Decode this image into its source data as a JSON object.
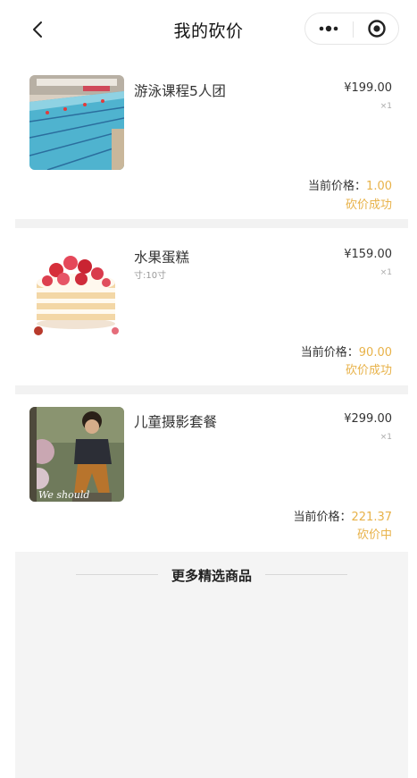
{
  "nav": {
    "title": "我的砍价"
  },
  "products": [
    {
      "name": "游泳课程5人团",
      "spec": "",
      "price": "¥199.00",
      "qty": "×1",
      "current_label": "当前价格：",
      "current_value": "1.00",
      "status": "砍价成功",
      "image": "pool-icon"
    },
    {
      "name": "水果蛋糕",
      "spec": "寸:10寸",
      "price": "¥159.00",
      "qty": "×1",
      "current_label": "当前价格：",
      "current_value": "90.00",
      "status": "砍价成功",
      "image": "cake-icon"
    },
    {
      "name": "儿童摄影套餐",
      "spec": "",
      "price": "¥299.00",
      "qty": "×1",
      "current_label": "当前价格：",
      "current_value": "221.37",
      "status": "砍价中",
      "image": "photo-icon"
    }
  ],
  "more": {
    "title": "更多精选商品"
  },
  "colors": {
    "accent": "#e8b249",
    "gap": "#f2f2f2"
  }
}
